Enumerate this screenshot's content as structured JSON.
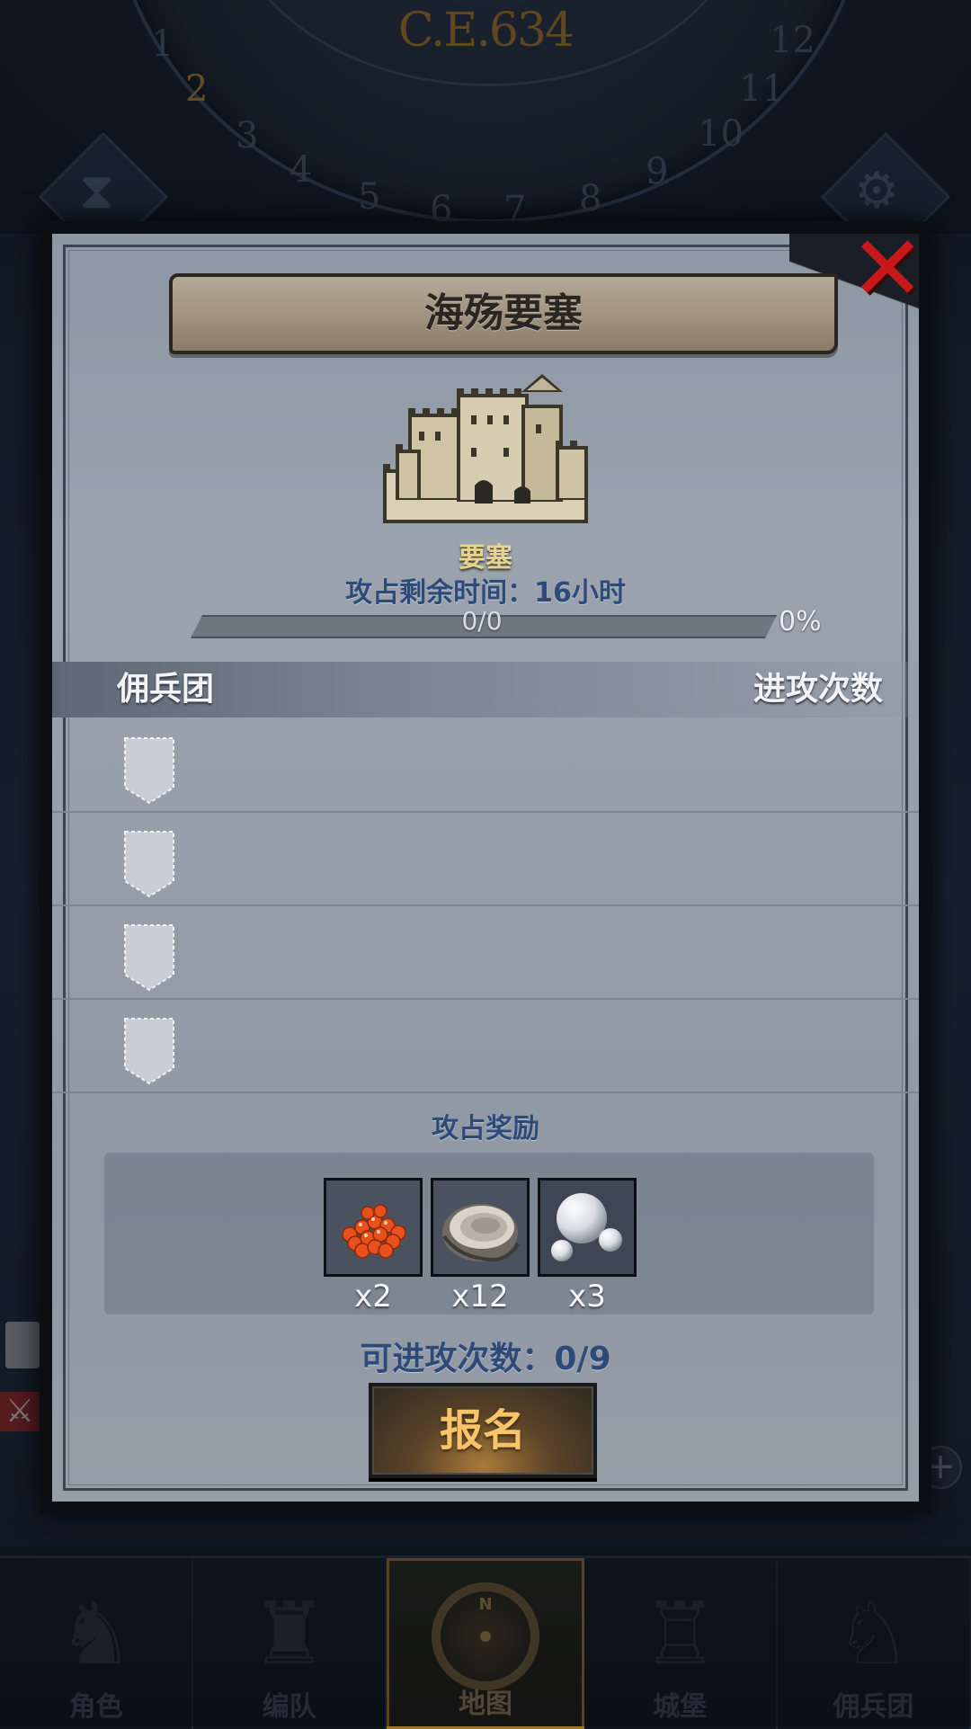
{
  "background": {
    "era_label": "C.E.634",
    "months": [
      "1",
      "2",
      "3",
      "4",
      "5",
      "6",
      "7",
      "8",
      "9",
      "10",
      "11",
      "12"
    ],
    "active_month": "2"
  },
  "modal": {
    "title": "海殇要塞",
    "fortress_type": "要塞",
    "time_label": "攻占剩余时间：",
    "time_value": "16小时",
    "progress": {
      "text": "0/0",
      "percent_text": "0%",
      "fraction": 0
    },
    "table": {
      "col_left": "佣兵团",
      "col_right": "进攻次数",
      "rows": [
        {},
        {},
        {},
        {}
      ]
    },
    "rewards": {
      "title": "攻占奖励",
      "items": [
        {
          "icon": "roe-icon",
          "count": "x2"
        },
        {
          "icon": "oyster-icon",
          "count": "x12"
        },
        {
          "icon": "pearl-icon",
          "count": "x3"
        }
      ]
    },
    "attempts_label": "可进攻次数：",
    "attempts_value": "0/9",
    "signup_label": "报名"
  },
  "bottom_nav": [
    {
      "label": "角色",
      "icon": "knight-icon"
    },
    {
      "label": "编队",
      "icon": "helmet-icon"
    },
    {
      "label": "地图",
      "icon": "compass-icon",
      "active": true
    },
    {
      "label": "城堡",
      "icon": "castle-icon"
    },
    {
      "label": "佣兵团",
      "icon": "mercenary-icon"
    }
  ],
  "colors": {
    "accent_gold": "#c9a24a",
    "close_red": "#c8181a",
    "text_blue": "#2e4a78"
  }
}
